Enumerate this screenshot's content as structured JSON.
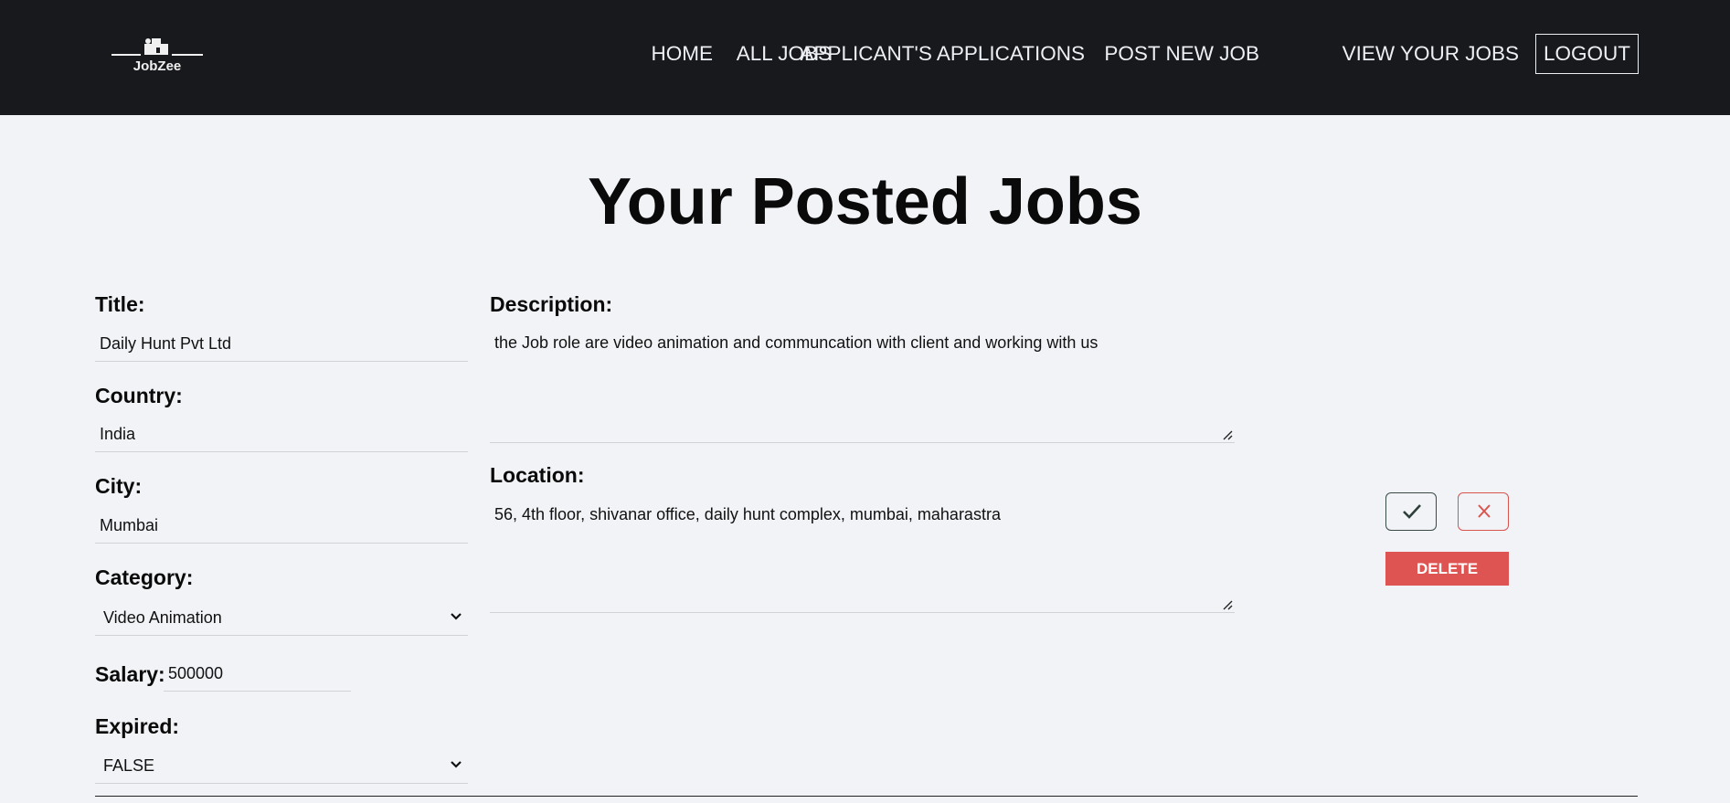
{
  "brand": {
    "name": "JobZee"
  },
  "nav": {
    "home": "HOME",
    "all_jobs": "ALL JOBS",
    "applications": "APPLICANT'S APPLICATIONS",
    "post_job": "POST NEW JOB",
    "view_jobs": "VIEW YOUR JOBS",
    "logout": "LOGOUT"
  },
  "page": {
    "title": "Your Posted Jobs"
  },
  "job": {
    "title_label": "Title:",
    "title_value": "Daily Hunt Pvt Ltd",
    "country_label": "Country:",
    "country_value": "India",
    "city_label": "City:",
    "city_value": "Mumbai",
    "category_label": "Category:",
    "category_value": "Video Animation",
    "salary_label": "Salary:",
    "salary_value": "500000",
    "expired_label": "Expired:",
    "expired_value": "FALSE",
    "description_label": "Description:",
    "description_value": "the Job role are video animation and communcation with client and working with us",
    "location_label": "Location:",
    "location_value": "56, 4th floor, shivanar office, daily hunt complex, mumbai, maharastra"
  },
  "actions": {
    "confirm_icon": "check-icon",
    "cancel_icon": "close-icon",
    "delete_label": "DELETE"
  },
  "colors": {
    "navbar_bg": "#18191d",
    "page_bg": "#f1f3f6",
    "delete_bg": "#de5452",
    "cancel_border": "#d9534f",
    "check_border": "#3a4a45"
  }
}
